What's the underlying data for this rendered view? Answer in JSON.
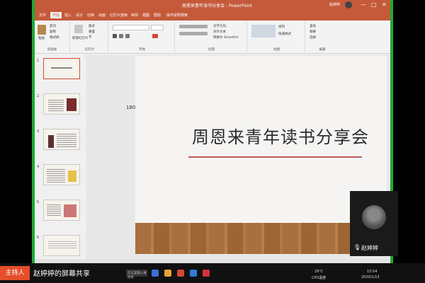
{
  "window": {
    "title": "周恩来青年读书分享会 - PowerPoint",
    "user": "赵婷婷",
    "controls": [
      "—",
      "□",
      "✕"
    ]
  },
  "ribbon_tabs": [
    "文件",
    "开始",
    "插入",
    "设计",
    "切换",
    "动画",
    "幻灯片放映",
    "审阅",
    "视图",
    "帮助",
    "操作说明搜索"
  ],
  "active_tab": "开始",
  "ribbon": {
    "clipboard": {
      "label": "剪贴板",
      "paste": "粘贴",
      "cut": "剪切",
      "copy": "复制",
      "format": "格式刷"
    },
    "slides": {
      "label": "幻灯片",
      "new": "新建幻灯片",
      "layout": "版式",
      "reset": "重置",
      "section": "节"
    },
    "font": {
      "label": "字体"
    },
    "paragraph": {
      "label": "段落",
      "text_dir": "文字方向",
      "align": "对齐文本",
      "smartart": "转换为 SmartArt"
    },
    "drawing": {
      "label": "绘图",
      "arrange": "排列",
      "quick": "快速样式"
    },
    "editing": {
      "label": "编辑",
      "find": "查找",
      "replace": "替换",
      "select": "选择"
    }
  },
  "thumbnails": [
    "1",
    "2",
    "3",
    "4",
    "5",
    "6"
  ],
  "slide": {
    "title": "周恩来青年读书分享会",
    "side_text": "1805班团支部"
  },
  "meeting": {
    "host_badge": "主持人",
    "share_label": "赵婷婷的屏幕共享",
    "camera_name": "赵婷婷"
  },
  "taskbar": {
    "search": "在这里输入要搜索",
    "temp": "29°C",
    "cpu": "CPU温度",
    "time": "15:54",
    "date": "2020/1/13"
  },
  "colors": {
    "accent": "#c55a3a",
    "host": "#e44e2a",
    "green": "#1fa832"
  }
}
